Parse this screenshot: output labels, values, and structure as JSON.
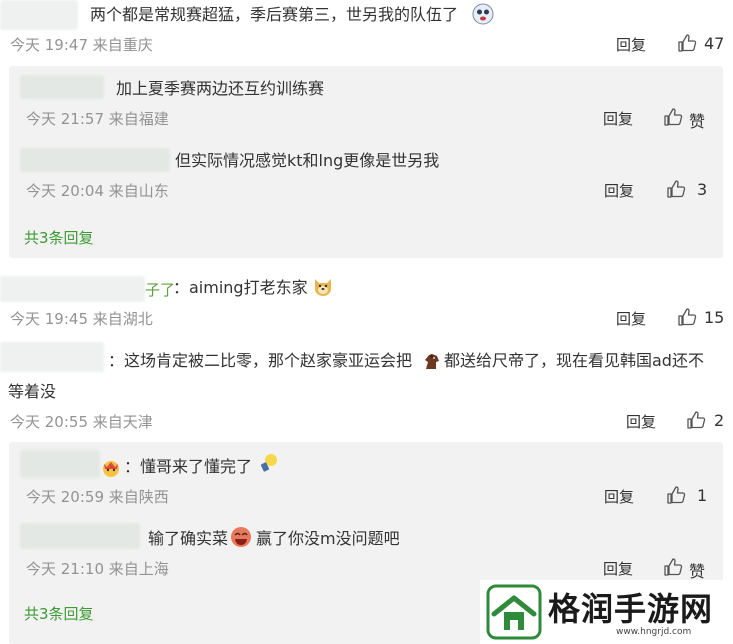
{
  "comments": [
    {
      "text": "两个都是常规赛超猛，季后赛第三，世另我的队伍了",
      "meta": "今天 19:47 来自重庆",
      "reply": "回复",
      "likes": "47",
      "replies": [
        {
          "text": "加上夏季赛两边还互约训练赛",
          "meta": "今天 21:57 来自福建",
          "reply": "回复",
          "likes": "赞"
        },
        {
          "text": "但实际情况感觉kt和lng更像是世另我",
          "meta": "今天 20:04 来自山东",
          "reply": "回复",
          "likes": "3"
        }
      ],
      "more": "共3条回复"
    },
    {
      "user_tail": "子了",
      "text": "：aiming打老东家",
      "meta": "今天 19:45 来自湖北",
      "reply": "回复",
      "likes": "15"
    },
    {
      "text_line1": "：这场肯定被二比零，那个赵家豪亚运会把",
      "text_line1b": "都送给尺帝了，现在看见韩国ad还不",
      "text_line2": "等着没",
      "meta": "今天 20:55 来自天津",
      "reply": "回复",
      "likes": "2",
      "replies": [
        {
          "text": "：懂哥来了懂完了",
          "meta": "今天 20:59 来自陕西",
          "reply": "回复",
          "likes": "1"
        },
        {
          "text": "输了确实菜",
          "text_b": "赢了你没m没问题吧",
          "meta": "今天 21:10 来自上海",
          "reply": "回复",
          "likes": "赞"
        }
      ],
      "more": "共3条回复"
    }
  ],
  "watermark": {
    "title": "格润手游网",
    "url": "www.hngrjd.com"
  },
  "icons": {
    "like": "thumbs-up-icon"
  }
}
